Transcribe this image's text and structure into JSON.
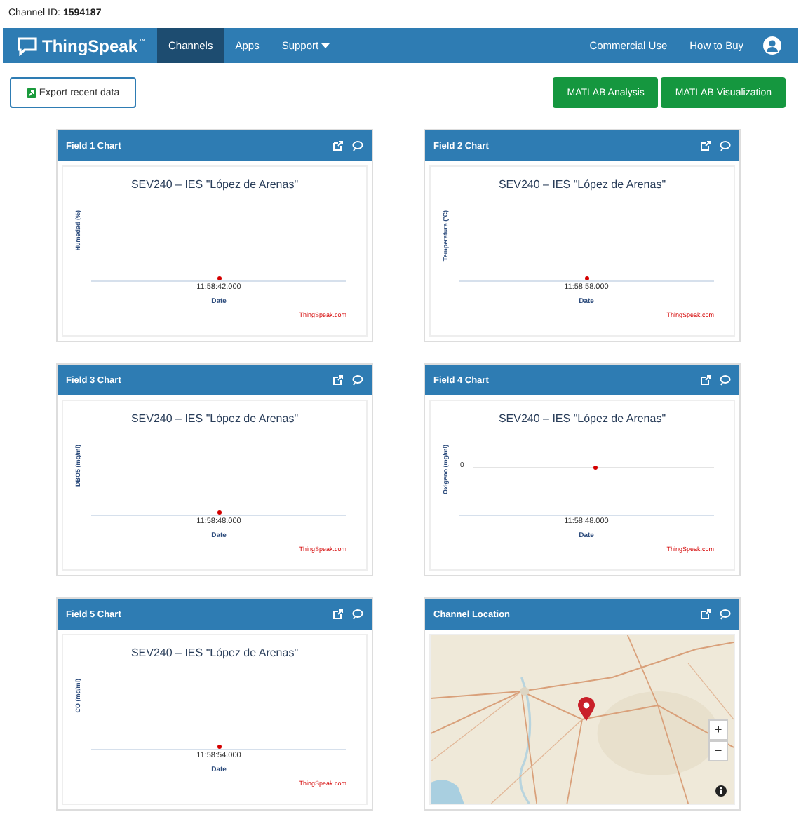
{
  "channel_info": {
    "label": "Channel ID:",
    "value": "1594187"
  },
  "navbar": {
    "logo": "ThingSpeak",
    "trademark": "™",
    "items": [
      {
        "label": "Channels",
        "selected": true,
        "kind": "link"
      },
      {
        "label": "Apps",
        "selected": false,
        "kind": "link"
      },
      {
        "label": "Support",
        "selected": false,
        "kind": "dropdown"
      }
    ],
    "right_items": [
      "Commercial Use",
      "How to Buy"
    ]
  },
  "export_button": "Export recent data",
  "action_buttons": [
    "MATLAB Analysis",
    "MATLAB Visualization"
  ],
  "panels": [
    {
      "kind": "chart",
      "title": "Field 1 Chart",
      "chart_title": "SEV240 – IES \"López de Arenas\"",
      "ylabel": "Humedad (%)",
      "time": "11:58:42.000",
      "xlabel": "Date",
      "credit": "ThingSpeak.com"
    },
    {
      "kind": "chart",
      "title": "Field 2 Chart",
      "chart_title": "SEV240 – IES \"López de Arenas\"",
      "ylabel": "Temperatura (ºC)",
      "time": "11:58:58.000",
      "xlabel": "Date",
      "credit": "ThingSpeak.com"
    },
    {
      "kind": "chart",
      "title": "Field 3 Chart",
      "chart_title": "SEV240 – IES \"López de Arenas\"",
      "ylabel": "DBO5 (mg/ml)",
      "time": "11:58:48.000",
      "xlabel": "Date",
      "credit": "ThingSpeak.com"
    },
    {
      "kind": "chart",
      "title": "Field 4 Chart",
      "chart_title": "SEV240 – IES \"López de Arenas\"",
      "ylabel": "Oxígeno (mg/ml)",
      "ytick": "0",
      "time": "11:58:48.000",
      "xlabel": "Date",
      "credit": "ThingSpeak.com"
    },
    {
      "kind": "chart",
      "title": "Field 5 Chart",
      "chart_title": "SEV240 – IES \"López de Arenas\"",
      "ylabel": "CO (mg/ml)",
      "time": "11:58:54.000",
      "xlabel": "Date",
      "credit": "ThingSpeak.com"
    },
    {
      "kind": "map",
      "title": "Channel Location",
      "zoom_in": "+",
      "zoom_out": "−"
    }
  ]
}
